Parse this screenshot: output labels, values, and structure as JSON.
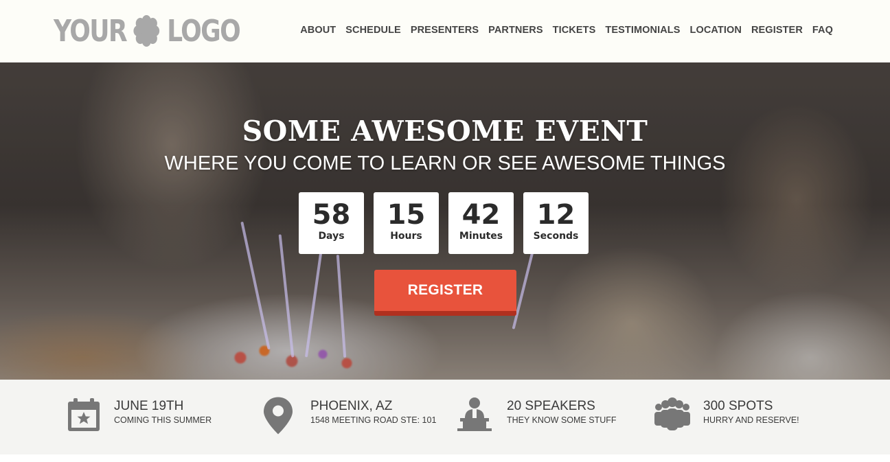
{
  "header": {
    "logo_left": "YOUR",
    "logo_right": "LOGO",
    "nav": [
      "ABOUT",
      "SCHEDULE",
      "PRESENTERS",
      "PARTNERS",
      "TICKETS",
      "TESTIMONIALS",
      "LOCATION",
      "REGISTER",
      "FAQ"
    ]
  },
  "hero": {
    "title": "SOME AWESOME EVENT",
    "subtitle": "WHERE YOU COME TO LEARN OR SEE AWESOME THINGS",
    "countdown": [
      {
        "value": "58",
        "label": "Days"
      },
      {
        "value": "15",
        "label": "Hours"
      },
      {
        "value": "42",
        "label": "Minutes"
      },
      {
        "value": "12",
        "label": "Seconds"
      }
    ],
    "register_label": "REGISTER"
  },
  "info": [
    {
      "icon": "calendar-icon",
      "title": "JUNE 19TH",
      "desc": "COMING THIS SUMMER"
    },
    {
      "icon": "map-pin-icon",
      "title": "PHOENIX, AZ",
      "desc": "1548 MEETING ROAD STE: 101"
    },
    {
      "icon": "speaker-podium-icon",
      "title": "20 SPEAKERS",
      "desc": "THEY KNOW SOME STUFF"
    },
    {
      "icon": "people-group-icon",
      "title": "300 SPOTS",
      "desc": "HURRY AND RESERVE!"
    }
  ],
  "colors": {
    "accent": "#e8533c",
    "accent_dark": "#b0301f",
    "icon_gray": "#777777",
    "logo_gray": "#a8a8a8"
  }
}
